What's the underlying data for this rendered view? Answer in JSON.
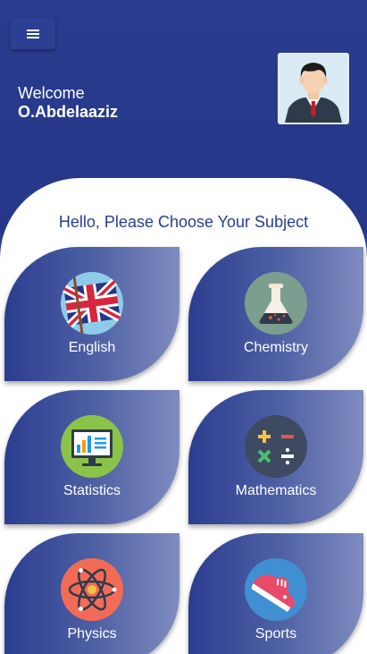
{
  "header": {
    "welcome_text": "Welcome",
    "user_name": "O.Abdelaaziz"
  },
  "content": {
    "title": "Hello, Please Choose Your Subject"
  },
  "subjects": [
    {
      "label": "English",
      "icon": "uk-flag-icon"
    },
    {
      "label": "Chemistry",
      "icon": "flask-icon"
    },
    {
      "label": "Statistics",
      "icon": "bar-chart-monitor-icon"
    },
    {
      "label": "Mathematics",
      "icon": "math-operators-icon"
    },
    {
      "label": "Physics",
      "icon": "atom-icon"
    },
    {
      "label": "Sports",
      "icon": "sneaker-icon"
    }
  ],
  "colors": {
    "primary": "#2a3c8d",
    "tile_gradient_end": "#7f8cc0",
    "background": "#ffffff"
  }
}
